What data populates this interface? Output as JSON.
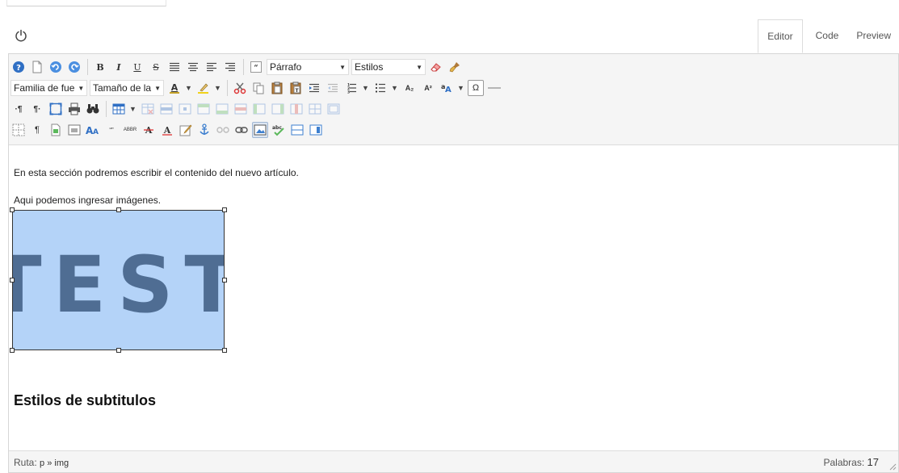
{
  "tabs": [
    {
      "label": "Editor",
      "active": true
    },
    {
      "label": "Code",
      "active": false
    },
    {
      "label": "Preview",
      "active": false
    }
  ],
  "toolbar": {
    "format_select": "Párrafo",
    "styles_select": "Estilos",
    "font_family_select": "Familia de fue",
    "font_size_select": "Tamaño de la",
    "bold": "B",
    "italic": "I",
    "underline": "U",
    "strike": "S",
    "subscript": "A₂",
    "superscript": "A²",
    "omega": "Ω"
  },
  "content": {
    "paragraph1": "En esta sección podremos escribir el contenido del nuevo artículo.",
    "paragraph2": "Aqui podemos ingresar imágenes.",
    "image_text": "TEST",
    "heading": "Estilos de subtitulos"
  },
  "status": {
    "path_label": "Ruta:",
    "path_value": "p » img",
    "words_label": "Palabras:",
    "words_count": "17"
  },
  "colors": {
    "accent_blue": "#3d7fcf",
    "image_bg": "#b4d3f8",
    "image_text": "#4f6d93",
    "toolbar_bg": "#f5f5f5"
  }
}
